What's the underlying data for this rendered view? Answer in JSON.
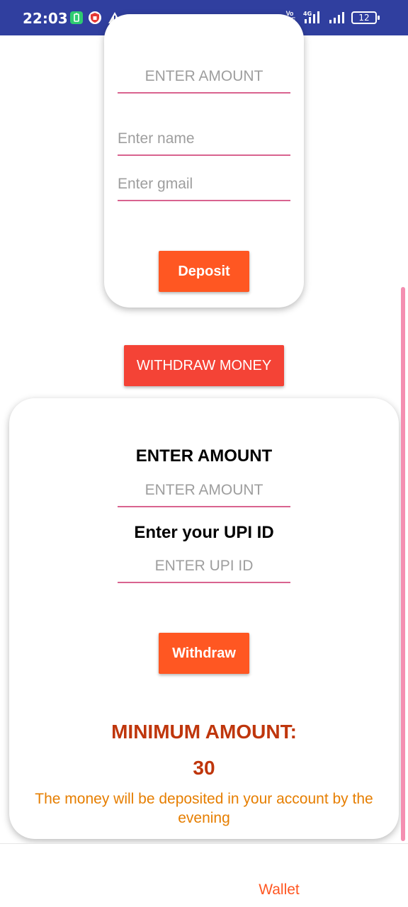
{
  "status_bar": {
    "time": "22:03",
    "icons": [
      "battery-app-icon",
      "shield-app-icon",
      "warning-icon",
      "volte-icon",
      "signal-4g-icon",
      "signal-icon"
    ],
    "volte_text": "VoLTE",
    "battery_level": "12"
  },
  "deposit": {
    "amount_placeholder": "ENTER AMOUNT",
    "name_placeholder": "Enter name",
    "gmail_placeholder": "Enter gmail",
    "button_label": "Deposit"
  },
  "withdraw_money_button": "WITHDRAW MONEY",
  "withdraw": {
    "amount_heading": "ENTER AMOUNT",
    "amount_placeholder": "ENTER AMOUNT",
    "upi_heading": "Enter your UPI ID",
    "upi_placeholder": "ENTER UPI ID",
    "button_label": "Withdraw",
    "minimum_label": "MINIMUM AMOUNT:",
    "minimum_value": "30",
    "note": "The money will be deposited in your account by the evening"
  },
  "bottom_nav": {
    "wallet_label": "Wallet"
  },
  "colors": {
    "status_bar": "#303f9f",
    "accent_button": "#ff5722",
    "withdraw_money_button": "#f44336",
    "field_underline": "#d9638f",
    "minimum_text": "#bf360c",
    "note_text": "#e67e00",
    "scrollbar": "#f48fb1"
  }
}
